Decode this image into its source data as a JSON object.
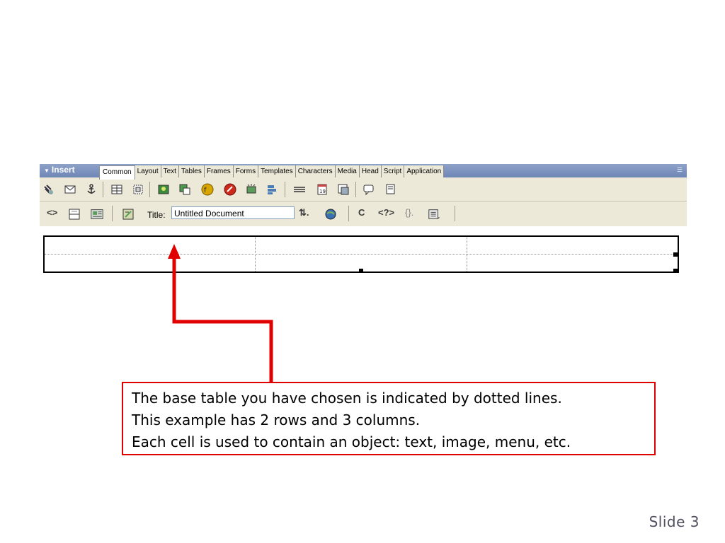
{
  "insert_panel": {
    "label": "Insert",
    "tabs": [
      "Common",
      "Layout",
      "Text",
      "Tables",
      "Frames",
      "Forms",
      "Templates",
      "Characters",
      "Media",
      "Head",
      "Script",
      "Application"
    ],
    "active_tab": "Common",
    "common_icons": [
      "hyperlink-icon",
      "email-link-icon",
      "named-anchor-icon",
      "table-icon",
      "layer-icon",
      "image-icon",
      "image-placeholder-icon",
      "flash-icon",
      "shockwave-icon",
      "rollover-image-icon",
      "navigation-bar-icon",
      "horizontal-rule-icon",
      "date-icon",
      "tabular-data-icon",
      "comment-icon",
      "tag-chooser-icon"
    ]
  },
  "document_toolbar": {
    "title_label": "Title:",
    "title_value": "Untitled Document"
  },
  "callout": {
    "lines": [
      "The base table you have chosen is indicated by dotted lines.",
      "This example has 2 rows and 3 columns.",
      "Each cell is used to contain an object: text, image, menu, etc."
    ]
  },
  "slide_label": "Slide 3",
  "colors": {
    "arrow": "#e00000",
    "callout_border": "#e00000",
    "tab_bar": "#7f93bf",
    "toolbar_bg": "#ece9d8"
  }
}
